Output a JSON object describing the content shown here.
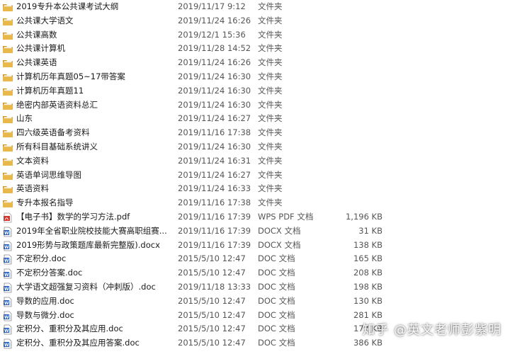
{
  "files": [
    {
      "name": "2019专升本公共课考试大纲",
      "date": "2019/11/17 9:12",
      "type": "文件夹",
      "size": "",
      "icon": "folder-icon"
    },
    {
      "name": "公共课大学语文",
      "date": "2019/11/24 16:26",
      "type": "文件夹",
      "size": "",
      "icon": "folder-icon"
    },
    {
      "name": "公共课高数",
      "date": "2019/12/1 15:36",
      "type": "文件夹",
      "size": "",
      "icon": "folder-icon"
    },
    {
      "name": "公共课计算机",
      "date": "2019/11/28 14:52",
      "type": "文件夹",
      "size": "",
      "icon": "folder-icon"
    },
    {
      "name": "公共课英语",
      "date": "2019/11/24 16:26",
      "type": "文件夹",
      "size": "",
      "icon": "folder-icon"
    },
    {
      "name": "计算机历年真题05~17带答案",
      "date": "2019/11/24 16:30",
      "type": "文件夹",
      "size": "",
      "icon": "folder-icon"
    },
    {
      "name": "计算机历年真题11",
      "date": "2019/11/24 16:30",
      "type": "文件夹",
      "size": "",
      "icon": "folder-icon"
    },
    {
      "name": "绝密内部英语资料总汇",
      "date": "2019/11/24 16:30",
      "type": "文件夹",
      "size": "",
      "icon": "folder-icon"
    },
    {
      "name": "山东",
      "date": "2019/11/24 16:27",
      "type": "文件夹",
      "size": "",
      "icon": "folder-icon"
    },
    {
      "name": "四六级英语备考资料",
      "date": "2019/11/16 17:38",
      "type": "文件夹",
      "size": "",
      "icon": "folder-icon"
    },
    {
      "name": "所有科目基础系统讲义",
      "date": "2019/11/24 16:30",
      "type": "文件夹",
      "size": "",
      "icon": "folder-icon"
    },
    {
      "name": "文本资料",
      "date": "2019/11/24 16:31",
      "type": "文件夹",
      "size": "",
      "icon": "folder-icon"
    },
    {
      "name": "英语单词思维导图",
      "date": "2019/11/24 16:27",
      "type": "文件夹",
      "size": "",
      "icon": "folder-icon"
    },
    {
      "name": "英语资料",
      "date": "2019/11/24 16:33",
      "type": "文件夹",
      "size": "",
      "icon": "folder-icon"
    },
    {
      "name": "专升本报名指导",
      "date": "2019/11/16 17:38",
      "type": "文件夹",
      "size": "",
      "icon": "folder-icon"
    },
    {
      "name": "【电子书】数学的学习方法.pdf",
      "date": "2019/11/16 17:39",
      "type": "WPS PDF 文档",
      "size": "1,196 KB",
      "icon": "pdf-icon"
    },
    {
      "name": "2019年全省职业院校技能大赛高职组赛...",
      "date": "2019/11/16 17:39",
      "type": "DOCX 文档",
      "size": "31 KB",
      "icon": "docx-icon"
    },
    {
      "name": "2019形势与政策题库最新完整版).docx",
      "date": "2019/11/16 17:39",
      "type": "DOCX 文档",
      "size": "138 KB",
      "icon": "docx-icon"
    },
    {
      "name": "不定积分.doc",
      "date": "2015/5/10 12:47",
      "type": "DOC 文档",
      "size": "165 KB",
      "icon": "doc-icon"
    },
    {
      "name": "不定积分答案.doc",
      "date": "2015/5/10 12:47",
      "type": "DOC 文档",
      "size": "208 KB",
      "icon": "doc-icon"
    },
    {
      "name": "大学语文超强复习资料（冲刺版）.doc",
      "date": "2019/11/18 13:33",
      "type": "DOC 文档",
      "size": "198 KB",
      "icon": "doc-icon"
    },
    {
      "name": "导数的应用.doc",
      "date": "2015/5/10 12:47",
      "type": "DOC 文档",
      "size": "130 KB",
      "icon": "doc-icon"
    },
    {
      "name": "导数与微分.doc",
      "date": "2015/5/10 12:47",
      "type": "DOC 文档",
      "size": "281 KB",
      "icon": "doc-icon"
    },
    {
      "name": "定积分、重积分及其应用.doc",
      "date": "2015/5/10 12:47",
      "type": "DOC 文档",
      "size": "177 KB",
      "icon": "doc-icon"
    },
    {
      "name": "定积分、重积分及其应用答案.doc",
      "date": "2015/5/10 12:47",
      "type": "DOC 文档",
      "size": "386 KB",
      "icon": "doc-icon"
    }
  ],
  "watermark": "知乎 @英文老师彭紫明",
  "colors": {
    "folder": "#e8b84a",
    "folder_dark": "#c9942a",
    "pdf": "#d9342b",
    "doc": "#2b5fb8"
  }
}
